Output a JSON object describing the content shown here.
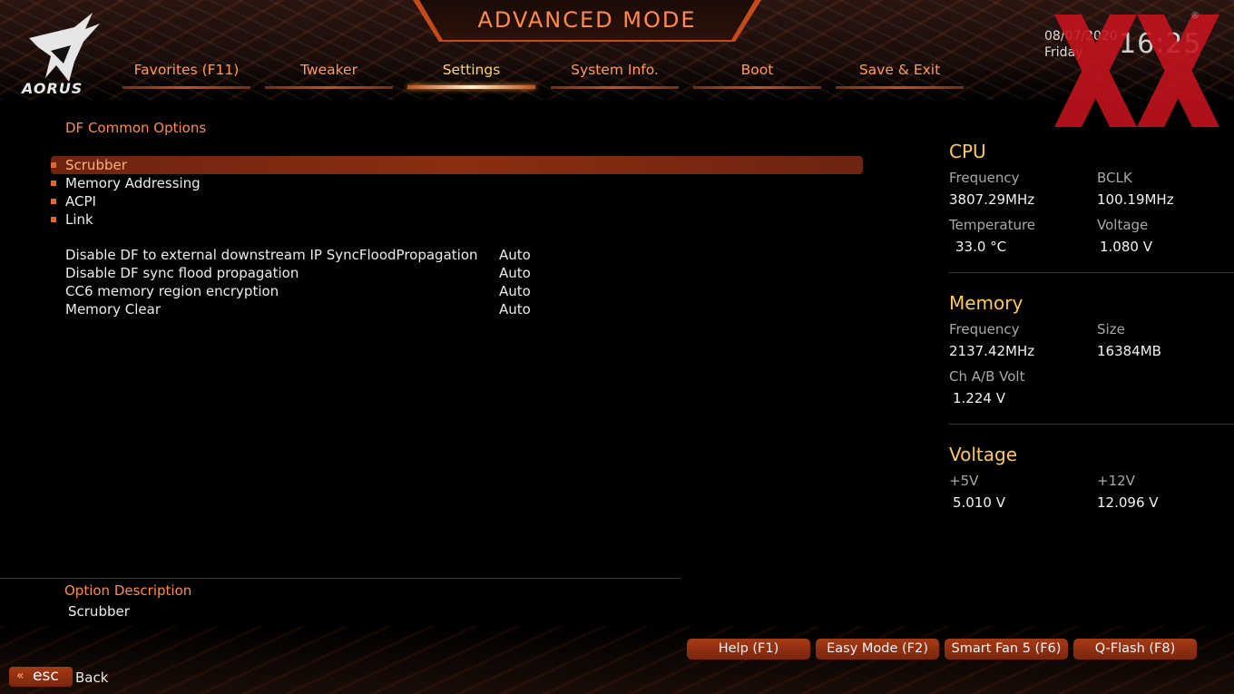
{
  "header": {
    "title": "ADVANCED MODE",
    "logo_text": "AORUS",
    "date": "08/07/2020",
    "day": "Friday",
    "time": "16:25"
  },
  "tabs": [
    {
      "label": "Favorites (F11)"
    },
    {
      "label": "Tweaker"
    },
    {
      "label": "Settings",
      "active": true
    },
    {
      "label": "System Info."
    },
    {
      "label": "Boot"
    },
    {
      "label": "Save & Exit"
    }
  ],
  "main": {
    "section_title": "DF Common Options",
    "submenus": [
      {
        "label": "Scrubber",
        "selected": true
      },
      {
        "label": "Memory Addressing"
      },
      {
        "label": "ACPI"
      },
      {
        "label": "Link"
      }
    ],
    "options": [
      {
        "label": "Disable DF to external downstream IP SyncFloodPropagation",
        "value": "Auto"
      },
      {
        "label": "Disable DF sync flood propagation",
        "value": "Auto"
      },
      {
        "label": "CC6 memory region encryption",
        "value": "Auto"
      },
      {
        "label": "Memory Clear",
        "value": "Auto"
      }
    ]
  },
  "description": {
    "title": "Option Description",
    "text": "Scrubber"
  },
  "sidebar": {
    "cpu": {
      "title": "CPU",
      "frequency_label": "Frequency",
      "frequency": "3807.29MHz",
      "bclk_label": "BCLK",
      "bclk": "100.19MHz",
      "temperature_label": "Temperature",
      "temperature": "33.0 °C",
      "voltage_label": "Voltage",
      "voltage": "1.080 V"
    },
    "memory": {
      "title": "Memory",
      "frequency_label": "Frequency",
      "frequency": "2137.42MHz",
      "size_label": "Size",
      "size": "16384MB",
      "chab_label": "Ch A/B Volt",
      "chab": "1.224 V"
    },
    "voltage": {
      "title": "Voltage",
      "v5_label": "+5V",
      "v5": "5.010 V",
      "v12_label": "+12V",
      "v12": "12.096 V"
    }
  },
  "footer": {
    "buttons": [
      {
        "label": "Help (F1)"
      },
      {
        "label": "Easy Mode (F2)"
      },
      {
        "label": "Smart Fan 5 (F6)"
      },
      {
        "label": "Q-Flash (F8)"
      }
    ],
    "esc_key": "esc",
    "back_label": "Back"
  },
  "colors": {
    "accent_orange": "#ff8a4a",
    "highlight_yellow": "#ffc95a",
    "selection_bar": "#8a2e12",
    "button_red": "#a63a14"
  }
}
